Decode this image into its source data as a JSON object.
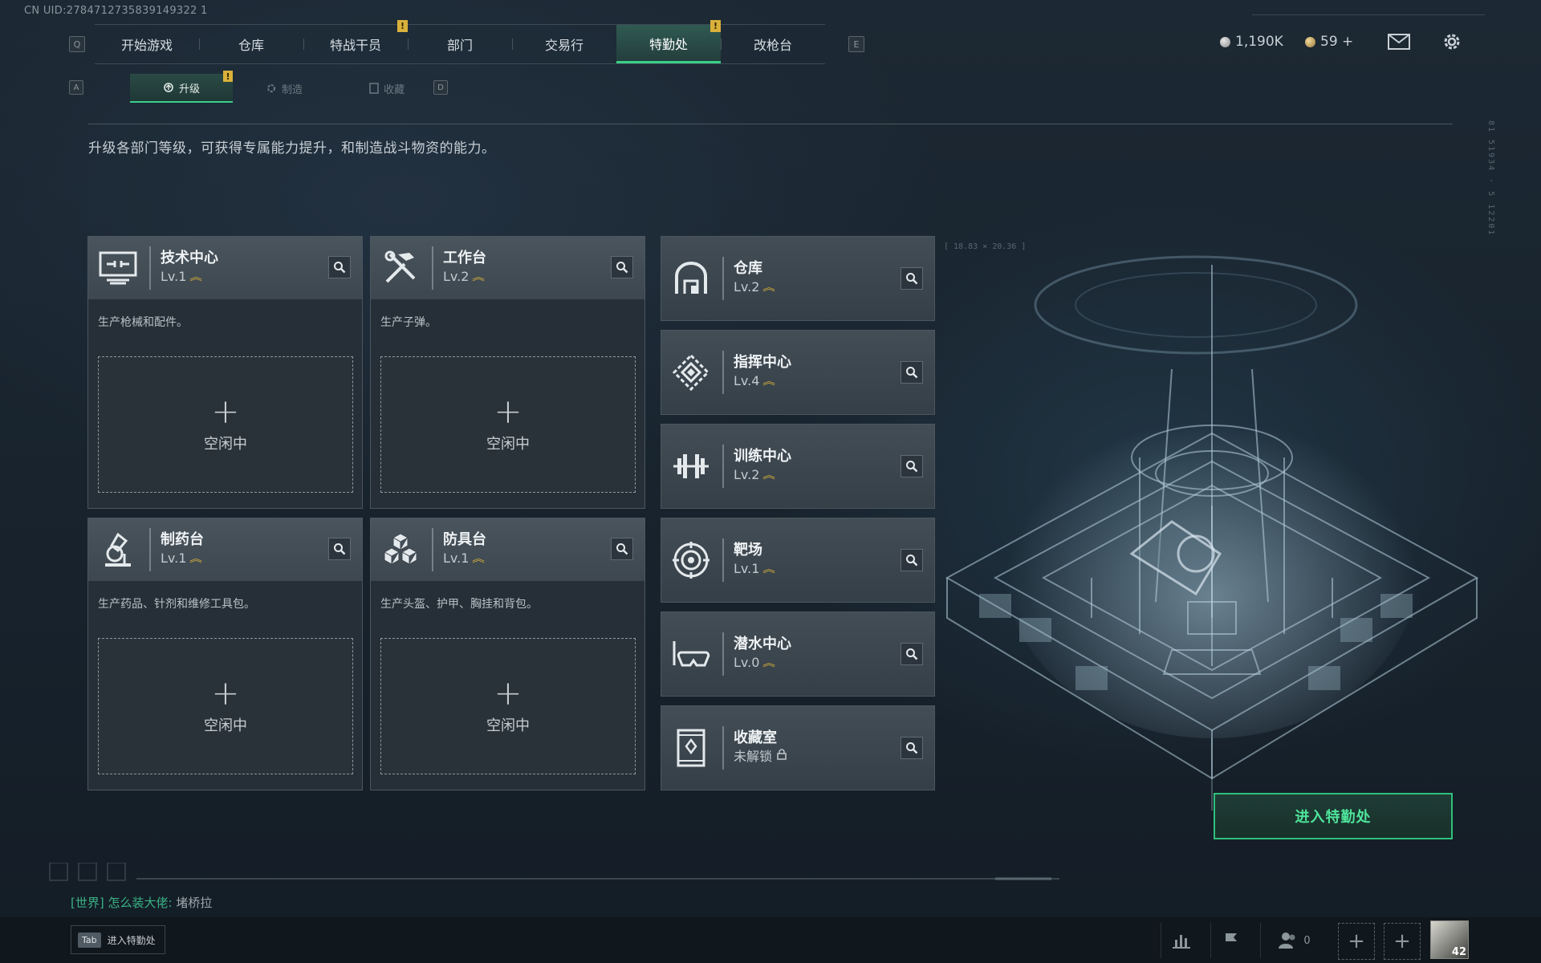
{
  "uid": "CN UID:2784712735839149322 1",
  "nav": {
    "key_left": "Q",
    "key_right": "E",
    "tabs": [
      "开始游戏",
      "仓库",
      "特战干员",
      "部门",
      "交易行",
      "特勤处",
      "改枪台"
    ],
    "alert_mark": "!"
  },
  "currency": {
    "money": "1,190K",
    "coins": "59 +"
  },
  "subnav": {
    "key_left": "A",
    "key_right": "D",
    "tabs": [
      "升级",
      "制造",
      "收藏"
    ],
    "alert_mark": "!"
  },
  "description": "升级各部门等级，可获得专属能力提升，和制造战斗物资的能力。",
  "idle_label": "空闲中",
  "workshops": [
    {
      "title": "技术中心",
      "level": "Lv.1",
      "desc": "生产枪械和配件。"
    },
    {
      "title": "工作台",
      "level": "Lv.2",
      "desc": "生产子弹。"
    },
    {
      "title": "制药台",
      "level": "Lv.1",
      "desc": "生产药品、针剂和维修工具包。"
    },
    {
      "title": "防具台",
      "level": "Lv.1",
      "desc": "生产头盔、护甲、胸挂和背包。"
    }
  ],
  "facilities": [
    {
      "title": "仓库",
      "level": "Lv.2"
    },
    {
      "title": "指挥中心",
      "level": "Lv.4"
    },
    {
      "title": "训练中心",
      "level": "Lv.2"
    },
    {
      "title": "靶场",
      "level": "Lv.1"
    },
    {
      "title": "潜水中心",
      "level": "Lv.0"
    },
    {
      "title": "收藏室",
      "level": "未解锁"
    }
  ],
  "coords_text": "[ 18.83 × 20.36 ]",
  "vert_text": "81 51934 · 5 12201",
  "enter_button": "进入特勤处",
  "chat": {
    "channel": "[世界]",
    "user": "怎么装大佬:",
    "message": "堵桥拉"
  },
  "tab_hint": {
    "key": "Tab",
    "label": "进入特勤处"
  },
  "friends_count": "0",
  "avatar_level": "42",
  "colors": {
    "accent": "#3ad08a",
    "alert": "#d9b13a",
    "bg": "#18232d"
  }
}
